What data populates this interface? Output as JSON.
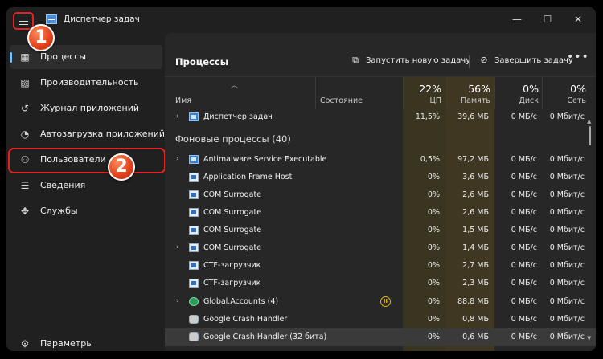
{
  "window": {
    "title": "Диспетчер задач",
    "controls": {
      "minimize": "—",
      "maximize": "☐",
      "close": "✕"
    }
  },
  "sidebar": {
    "items": [
      {
        "label": "Процессы",
        "icon": "grid-icon",
        "glyph": "▦"
      },
      {
        "label": "Производительность",
        "icon": "activity-icon",
        "glyph": "▨"
      },
      {
        "label": "Журнал приложений",
        "icon": "history-icon",
        "glyph": "↺"
      },
      {
        "label": "Автозагрузка приложений",
        "icon": "speedometer-icon",
        "glyph": "◔"
      },
      {
        "label": "Пользователи",
        "icon": "users-icon",
        "glyph": "⚇"
      },
      {
        "label": "Сведения",
        "icon": "list-icon",
        "glyph": "☰"
      },
      {
        "label": "Службы",
        "icon": "puzzle-icon",
        "glyph": "✥"
      }
    ],
    "settings": {
      "label": "Параметры",
      "glyph": "⚙"
    }
  },
  "toolbar": {
    "title": "Процессы",
    "new_task": "Запустить новую задачу",
    "end_task": "Завершить задачу",
    "more": "•••"
  },
  "table": {
    "columns": {
      "name": "Имя",
      "state": "Состояние",
      "cpu": {
        "pct": "22%",
        "label": "ЦП"
      },
      "memory": {
        "pct": "56%",
        "label": "Память"
      },
      "disk": {
        "pct": "0%",
        "label": "Диск"
      },
      "network": {
        "pct": "0%",
        "label": "Сеть"
      }
    },
    "section_title": "Фоновые процессы (40)",
    "rows": [
      {
        "name": "Диспетчер задач",
        "cpu": "11,5%",
        "mem": "39,6 МБ",
        "disk": "0 МБ/с",
        "net": "0 Мбит/с"
      },
      {
        "name": "Antimalware Service Executable",
        "cpu": "0,5%",
        "mem": "97,2 МБ",
        "disk": "0 МБ/с",
        "net": "0 Мбит/с"
      },
      {
        "name": "Application Frame Host",
        "cpu": "0%",
        "mem": "3,6 МБ",
        "disk": "0 МБ/с",
        "net": "0 Мбит/с"
      },
      {
        "name": "COM Surrogate",
        "cpu": "0%",
        "mem": "2,6 МБ",
        "disk": "0 МБ/с",
        "net": "0 Мбит/с"
      },
      {
        "name": "COM Surrogate",
        "cpu": "0%",
        "mem": "2,6 МБ",
        "disk": "0 МБ/с",
        "net": "0 Мбит/с"
      },
      {
        "name": "COM Surrogate",
        "cpu": "0%",
        "mem": "1,5 МБ",
        "disk": "0 МБ/с",
        "net": "0 Мбит/с"
      },
      {
        "name": "COM Surrogate",
        "cpu": "0%",
        "mem": "1,4 МБ",
        "disk": "0 МБ/с",
        "net": "0 Мбит/с"
      },
      {
        "name": "CTF-загрузчик",
        "cpu": "0%",
        "mem": "2,7 МБ",
        "disk": "0 МБ/с",
        "net": "0 Мбит/с"
      },
      {
        "name": "CTF-загрузчик",
        "cpu": "0%",
        "mem": "2,3 МБ",
        "disk": "0 МБ/с",
        "net": "0 Мбит/с"
      },
      {
        "name": "Global.Accounts (4)",
        "cpu": "0%",
        "mem": "88,8 МБ",
        "disk": "0 МБ/с",
        "net": "0 Мбит/с"
      },
      {
        "name": "Google Crash Handler",
        "cpu": "0%",
        "mem": "0,8 МБ",
        "disk": "0 МБ/с",
        "net": "0 Мбит/с"
      },
      {
        "name": "Google Crash Handler (32 бита)",
        "cpu": "0%",
        "mem": "0,6 МБ",
        "disk": "0 МБ/с",
        "net": "0 Мбит/с"
      }
    ],
    "pause_glyph": "II"
  },
  "badges": {
    "one": "1",
    "two": "2"
  },
  "colors": {
    "highlight": "#e32222",
    "accent": "#7cc3f5",
    "badge": "#e0401a"
  }
}
